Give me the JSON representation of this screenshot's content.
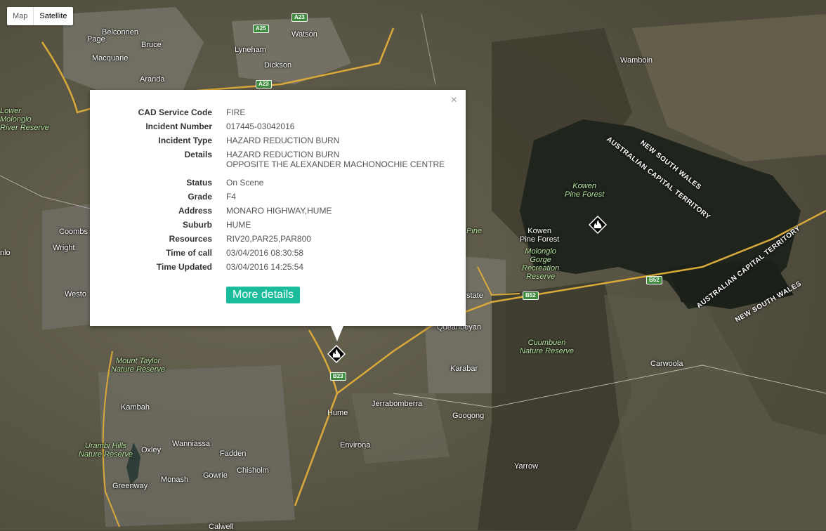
{
  "map_type": {
    "map_label": "Map",
    "satellite_label": "Satellite",
    "selected": "Satellite"
  },
  "info_window": {
    "close_symbol": "×",
    "fields": [
      {
        "label": "CAD Service Code",
        "value": "FIRE"
      },
      {
        "label": "Incident Number",
        "value": "017445-03042016"
      },
      {
        "label": "Incident Type",
        "value": "HAZARD REDUCTION BURN"
      },
      {
        "label": "Details",
        "value": "HAZARD REDUCTION BURN",
        "value2": "OPPOSITE THE ALEXANDER MACHONOCHIE CENTRE"
      },
      {
        "label": "Status",
        "value": "On Scene"
      },
      {
        "label": "Grade",
        "value": "F4"
      },
      {
        "label": "Address",
        "value": "MONARO HIGHWAY,HUME"
      },
      {
        "label": "Suburb",
        "value": "HUME"
      },
      {
        "label": "Resources",
        "value": "RIV20,PAR25,PAR800"
      },
      {
        "label": "Time of call",
        "value": "03/04/2016 08:30:58"
      },
      {
        "label": "Time Updated",
        "value": "03/04/2016 14:25:54"
      }
    ],
    "more_details_label": "More details",
    "button_color": "#1abc9c"
  },
  "places": {
    "belconnen": "Belconnen",
    "page": "Page",
    "bruce": "Bruce",
    "macquarie": "Macquarie",
    "aranda": "Aranda",
    "lyneham": "Lyneham",
    "watson": "Watson",
    "dickson": "Dickson",
    "wamboin": "Wamboin",
    "lower_molonglo": "Lower\nMolonglo\nRiver Reserve",
    "coombs": "Coombs",
    "wright": "Wright",
    "weston": "Westo",
    "nlo": "nlo",
    "kowen_pine_forest_green": "Kowen\nPine Forest",
    "kowen_pine_forest": "Kowen\nPine Forest",
    "molonglo_gorge": "Molonglo\nGorge\nRecreation\nReserve",
    "pine": "Pine",
    "estate": "state",
    "queanbeyan": "Queanbeyan",
    "karabar": "Karabar",
    "cuumbuen": "Cuumbuen\nNature Reserve",
    "carwoola": "Carwoola",
    "mount_taylor": "Mount Taylor\nNature Reserve",
    "hume": "Hume",
    "jerrabomberra": "Jerrabomberra",
    "googong": "Googong",
    "environa": "Environa",
    "kambah": "Kambah",
    "urambi": "Urambi Hills\nNature Reserve",
    "oxley": "Oxley",
    "wanniassa": "Wanniassa",
    "fadden": "Fadden",
    "chisholm": "Chisholm",
    "gowrie": "Gowrie",
    "monash": "Monash",
    "greenway": "Greenway",
    "yarrow": "Yarrow",
    "calwell": "Calwell"
  },
  "road_shields": {
    "a23_top": "A23",
    "a25": "A25",
    "a23_mid": "A23",
    "b52_left": "B52",
    "b52_right": "B52",
    "b23": "B23"
  },
  "border_labels": {
    "nsw_top": "NEW SOUTH WALES",
    "act_top": "AUSTRALIAN CAPITAL TERRITORY",
    "act_right": "AUSTRALIAN CAPITAL TERRITORY",
    "nsw_right": "NEW SOUTH WALES"
  },
  "markers": [
    {
      "name": "fire-incident-hume"
    },
    {
      "name": "fire-incident-kowen"
    }
  ]
}
